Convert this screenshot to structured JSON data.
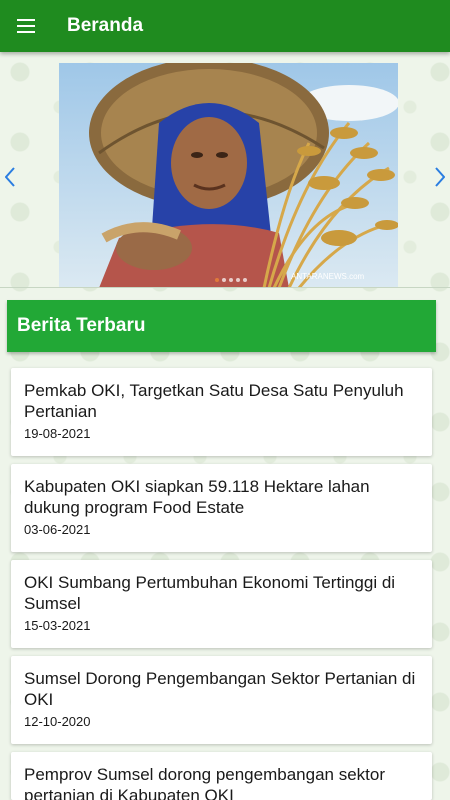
{
  "appbar": {
    "title": "Beranda",
    "menu_icon": "menu-icon",
    "color": "#1f8b1f"
  },
  "carousel": {
    "image_watermark": "ANTARANEWS.com",
    "prev_icon": "chevron-left-icon",
    "next_icon": "chevron-right-icon",
    "slide_count": 5,
    "active_slide": 1
  },
  "section": {
    "title": "Berita Terbaru",
    "color": "#22a836"
  },
  "news": [
    {
      "title": "Pemkab OKI, Targetkan Satu Desa Satu Penyuluh Pertanian",
      "date": "19-08-2021"
    },
    {
      "title": "Kabupaten OKI siapkan 59.118 Hektare lahan dukung program Food Estate",
      "date": "03-06-2021"
    },
    {
      "title": "OKI Sumbang Pertumbuhan Ekonomi Tertinggi di Sumsel",
      "date": "15-03-2021"
    },
    {
      "title": "Sumsel Dorong Pengembangan Sektor Pertanian di OKI",
      "date": "12-10-2020"
    },
    {
      "title": "Pemprov Sumsel dorong pengembangan sektor pertanian di Kabupaten OKI",
      "date": ""
    }
  ]
}
